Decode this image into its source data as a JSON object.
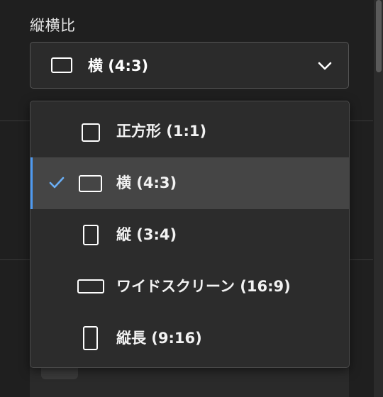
{
  "field": {
    "label": "縦横比",
    "selected_value": "横 (4:3)",
    "selected_icon": "landscape-4-3-icon"
  },
  "options": [
    {
      "label": "正方形 (1:1)",
      "icon": "square-1-1-icon",
      "selected": false
    },
    {
      "label": "横 (4:3)",
      "icon": "landscape-4-3-icon",
      "selected": true
    },
    {
      "label": "縦 (3:4)",
      "icon": "portrait-3-4-icon",
      "selected": false
    },
    {
      "label": "ワイドスクリーン (16:9)",
      "icon": "widescreen-16-9-icon",
      "selected": false
    },
    {
      "label": "縦長 (9:16)",
      "icon": "tall-9-16-icon",
      "selected": false
    }
  ],
  "colors": {
    "accent": "#4e9af1",
    "selected_row": "#454545",
    "panel": "#2c2c2c",
    "background": "#1f1f1f"
  }
}
